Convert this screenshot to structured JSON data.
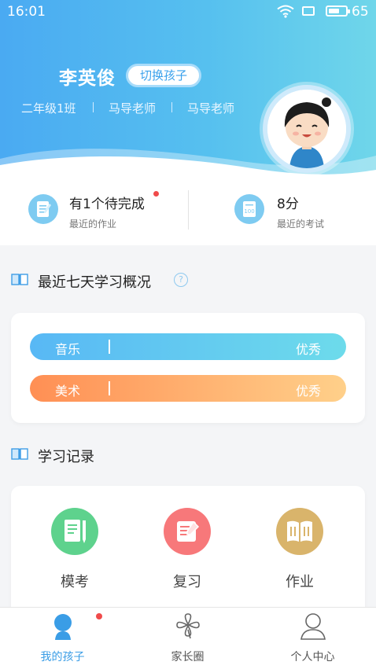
{
  "status_bar": {
    "time": "16:01",
    "battery_level": "65",
    "battery_fraction": 0.65
  },
  "profile": {
    "child_name": "李英俊",
    "switch_button": "切换孩子",
    "class_name": "二年级1班",
    "teachers": [
      "马导老师",
      "马导老师"
    ]
  },
  "summary": {
    "homework": {
      "title": "有1个待完成",
      "subtitle": "最近的作业",
      "has_badge": true
    },
    "exam": {
      "title": "8分",
      "subtitle": "最近的考试"
    }
  },
  "weekly_overview": {
    "title": "最近七天学习概况",
    "help_icon": "question-circle-icon",
    "subjects": [
      {
        "name": "音乐",
        "rating": "优秀",
        "color_from": "#58b8f5",
        "color_to": "#6ddbeb"
      },
      {
        "name": "美术",
        "rating": "优秀",
        "color_from": "#ff8f54",
        "color_to": "#ffd08a"
      }
    ]
  },
  "learning_records": {
    "title": "学习记录",
    "items": [
      {
        "label": "模考",
        "icon": "mock-exam-icon",
        "color": "#5ed28d"
      },
      {
        "label": "复习",
        "icon": "review-icon",
        "color": "#f7787a"
      },
      {
        "label": "作业",
        "icon": "homework-book-icon",
        "color": "#d9b46b"
      }
    ]
  },
  "tab_bar": {
    "tabs": [
      {
        "label": "我的孩子",
        "icon": "child-icon",
        "active": true,
        "badge": true
      },
      {
        "label": "家长圈",
        "icon": "clover-icon",
        "active": false
      },
      {
        "label": "个人中心",
        "icon": "person-icon",
        "active": false
      }
    ]
  },
  "colors": {
    "accent": "#3a9de6",
    "header_start": "#4aaaf2",
    "header_end": "#6fd6ea",
    "badge": "#f04b4b"
  }
}
